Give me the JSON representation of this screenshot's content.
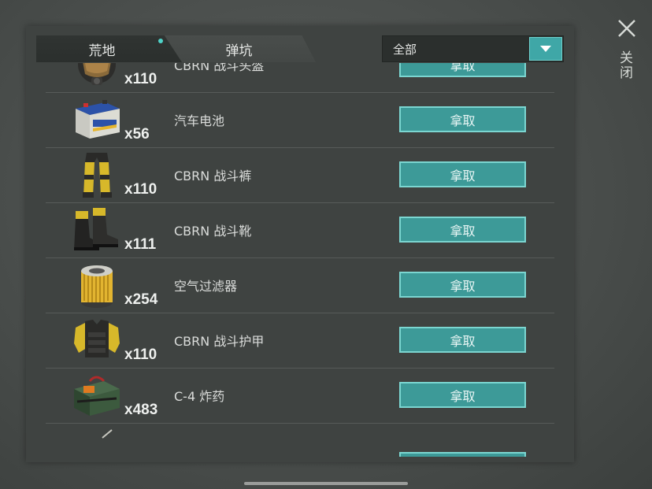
{
  "tabs": [
    {
      "label": "荒地",
      "active": true
    },
    {
      "label": "弹坑",
      "active": false
    }
  ],
  "filter": {
    "value": "全部"
  },
  "close_label": "关闭",
  "items": [
    {
      "name": "CBRN 战斗头盔",
      "qty": "x110",
      "action": "拿取",
      "icon": "gas-mask-helmet-icon"
    },
    {
      "name": "汽车电池",
      "qty": "x56",
      "action": "拿取",
      "icon": "car-battery-icon"
    },
    {
      "name": "CBRN 战斗裤",
      "qty": "x110",
      "action": "拿取",
      "icon": "combat-pants-icon"
    },
    {
      "name": "CBRN 战斗靴",
      "qty": "x111",
      "action": "拿取",
      "icon": "combat-boots-icon"
    },
    {
      "name": "空气过滤器",
      "qty": "x254",
      "action": "拿取",
      "icon": "air-filter-icon"
    },
    {
      "name": "CBRN 战斗护甲",
      "qty": "x110",
      "action": "拿取",
      "icon": "body-armor-icon"
    },
    {
      "name": "C-4 炸药",
      "qty": "x483",
      "action": "拿取",
      "icon": "c4-explosive-icon"
    }
  ],
  "colors": {
    "accent": "#3d9a98",
    "accent_border": "#7bd6d1",
    "panel": "#3f4341",
    "notify_dot": "#4fd3c9"
  }
}
